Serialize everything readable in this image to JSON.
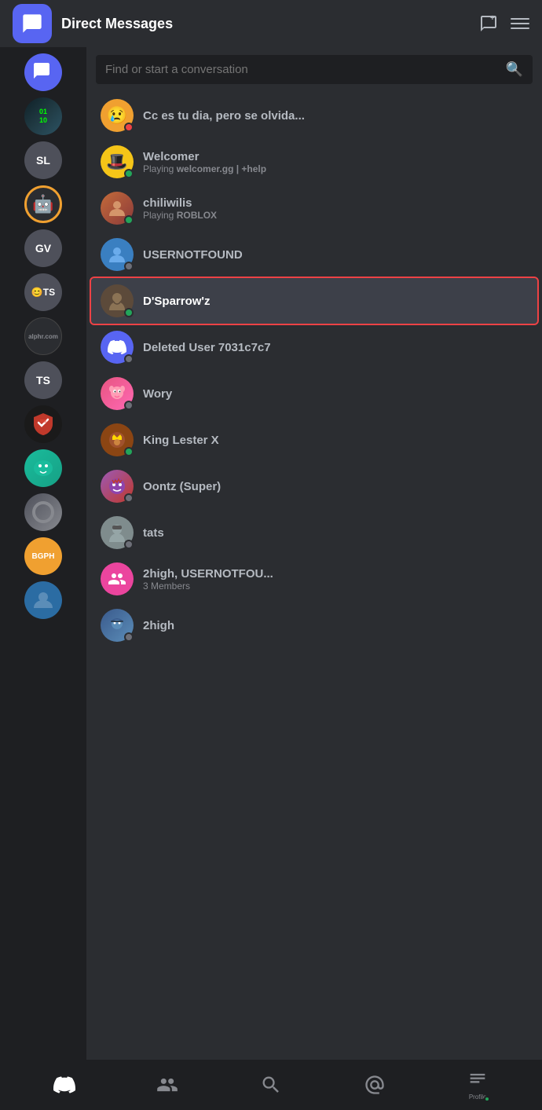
{
  "header": {
    "title": "Direct Messages",
    "search_placeholder": "Find or start a conversation"
  },
  "server_list": [
    {
      "id": "dm-icon",
      "label": "DM",
      "type": "icon",
      "color": "#5865f2"
    },
    {
      "id": "code-server",
      "label": "code",
      "type": "image",
      "bg": "#1a1a2e"
    },
    {
      "id": "sl-server",
      "label": "SL",
      "type": "text",
      "bg": "#4e505a"
    },
    {
      "id": "lego-server",
      "label": "lego",
      "type": "emoji",
      "emoji": "🤖",
      "bg": "#f0a030",
      "ring": true
    },
    {
      "id": "gv-server",
      "label": "GV",
      "type": "text",
      "bg": "#4e505a"
    },
    {
      "id": "emoji-ts",
      "label": "😊TS",
      "type": "text",
      "bg": "#4e505a"
    },
    {
      "id": "alphr-server",
      "label": "alphr.com",
      "type": "text",
      "bg": "#2b2d31",
      "fontSize": "9px"
    },
    {
      "id": "ts-server",
      "label": "TS",
      "type": "text",
      "bg": "#4e505a"
    },
    {
      "id": "red-server",
      "label": "red",
      "type": "image",
      "bg": "#ed4245"
    },
    {
      "id": "teal-server",
      "label": "teal",
      "type": "image",
      "bg": "#1abc9c"
    },
    {
      "id": "circle-server",
      "label": "circle",
      "type": "image",
      "bg": "#4e505a"
    },
    {
      "id": "bgph-server",
      "label": "BGPH",
      "type": "text",
      "bg": "#f0a030"
    },
    {
      "id": "photo-server",
      "label": "photo",
      "type": "image",
      "bg": "#2b6ca3"
    }
  ],
  "dm_list": [
    {
      "id": "dm-first",
      "name": "Cc es tu dia, pero se olvida...",
      "status": "offline",
      "avatar_type": "emoji",
      "avatar_emoji": "😢",
      "avatar_bg": "#f0a030",
      "show_dnd": true
    },
    {
      "id": "dm-welcomer",
      "name": "Welcomer",
      "status": "online",
      "status_type": "online",
      "sub": "Playing welcomer.gg | +help",
      "avatar_type": "emoji",
      "avatar_emoji": "🎩",
      "avatar_bg": "#f5c518"
    },
    {
      "id": "dm-chiliwilis",
      "name": "chiliwilis",
      "status_type": "online",
      "sub": "Playing ROBLOX",
      "sub_bold": "ROBLOX",
      "avatar_type": "color",
      "avatar_bg": "#c46b3a"
    },
    {
      "id": "dm-usernotfound",
      "name": "USERNOTFOUND",
      "status_type": "offline",
      "avatar_type": "color",
      "avatar_bg": "#3a7fc1"
    },
    {
      "id": "dm-dsparrowz",
      "name": "D'Sparrow'z",
      "status_type": "online",
      "avatar_type": "color",
      "avatar_bg": "#5c4a3a",
      "active": true
    },
    {
      "id": "dm-deleted",
      "name": "Deleted User 7031c7c7",
      "status_type": "offline",
      "avatar_type": "icon",
      "avatar_bg": "#5865f2"
    },
    {
      "id": "dm-wory",
      "name": "Wory",
      "status_type": "offline",
      "avatar_type": "color",
      "avatar_bg": "#e75480"
    },
    {
      "id": "dm-kinglester",
      "name": "King Lester X",
      "status_type": "online",
      "avatar_type": "color",
      "avatar_bg": "#8b4513"
    },
    {
      "id": "dm-oontz",
      "name": "Oontz (Super)",
      "status_type": "offline",
      "avatar_type": "color",
      "avatar_bg": "#9b59b6"
    },
    {
      "id": "dm-tats",
      "name": "tats",
      "status_type": "offline",
      "avatar_type": "color",
      "avatar_bg": "#7f8c8d"
    },
    {
      "id": "dm-2high-group",
      "name": "2high, USERNOTFOU...",
      "status_type": "none",
      "sub": "3 Members",
      "avatar_type": "group",
      "avatar_bg": "#eb459e"
    },
    {
      "id": "dm-2high",
      "name": "2high",
      "status_type": "offline",
      "avatar_type": "color",
      "avatar_bg": "#3a5a8c"
    }
  ],
  "bottom_nav": {
    "items": [
      {
        "id": "nav-discord",
        "icon": "discord",
        "label": "Discord"
      },
      {
        "id": "nav-friends",
        "icon": "friends",
        "label": "Friends"
      },
      {
        "id": "nav-search",
        "icon": "search",
        "label": "Search"
      },
      {
        "id": "nav-mentions",
        "icon": "mentions",
        "label": "Mentions"
      },
      {
        "id": "nav-profile",
        "icon": "profile",
        "label": "Profile",
        "has_dot": true
      }
    ]
  },
  "icons": {
    "new_dm": "🗨",
    "menu": "≡",
    "search": "🔍"
  }
}
